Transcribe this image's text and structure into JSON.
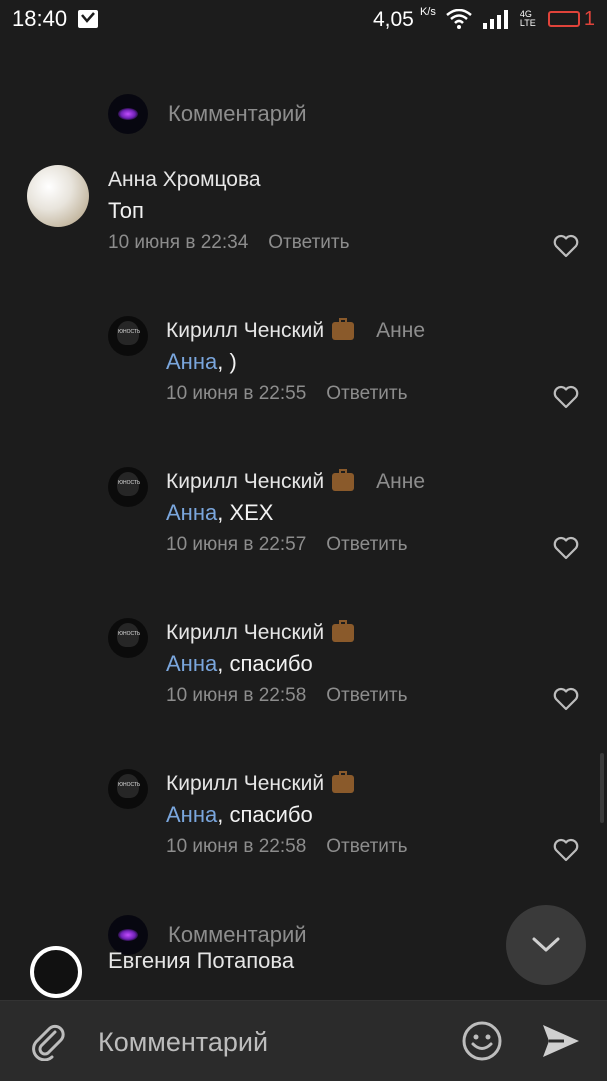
{
  "status_bar": {
    "time": "18:40",
    "net_speed": "4,05",
    "net_unit": "K/s",
    "network_type": "4G LTE",
    "battery_level": "1"
  },
  "prompts": {
    "comment_placeholder": "Комментарий"
  },
  "comments": [
    {
      "author": "Анна Хромцова",
      "text": "Топ",
      "date": "10 июня в 22:34",
      "reply_label": "Ответить"
    },
    {
      "author": "Кирилл Ченский",
      "reply_to": "Анне",
      "mention": "Анна",
      "text": ", )",
      "date": "10 июня в 22:55",
      "reply_label": "Ответить"
    },
    {
      "author": "Кирилл Ченский",
      "reply_to": "Анне",
      "mention": "Анна",
      "text": ", ХЕХ",
      "date": "10 июня в 22:57",
      "reply_label": "Ответить"
    },
    {
      "author": "Кирилл Ченский",
      "mention": "Анна",
      "text": ", спасибо",
      "date": "10 июня в 22:58",
      "reply_label": "Ответить"
    },
    {
      "author": "Кирилл Ченский",
      "mention": "Анна",
      "text": ", спасибо",
      "date": "10 июня в 22:58",
      "reply_label": "Ответить"
    }
  ],
  "next_author_partial": "Евгения Потапова",
  "avatar_label": "ЮНОСТЬ",
  "composer": {
    "placeholder": "Комментарий"
  },
  "colors": {
    "background": "#1c1c1c",
    "mention": "#7aa6dd",
    "muted": "#8d8d8d",
    "battery": "#e0433a"
  },
  "icons": [
    "wifi-icon",
    "signal-icon",
    "battery-icon",
    "briefcase-icon",
    "heart-icon",
    "chevron-down-icon",
    "paperclip-icon",
    "emoji-icon",
    "send-icon"
  ]
}
